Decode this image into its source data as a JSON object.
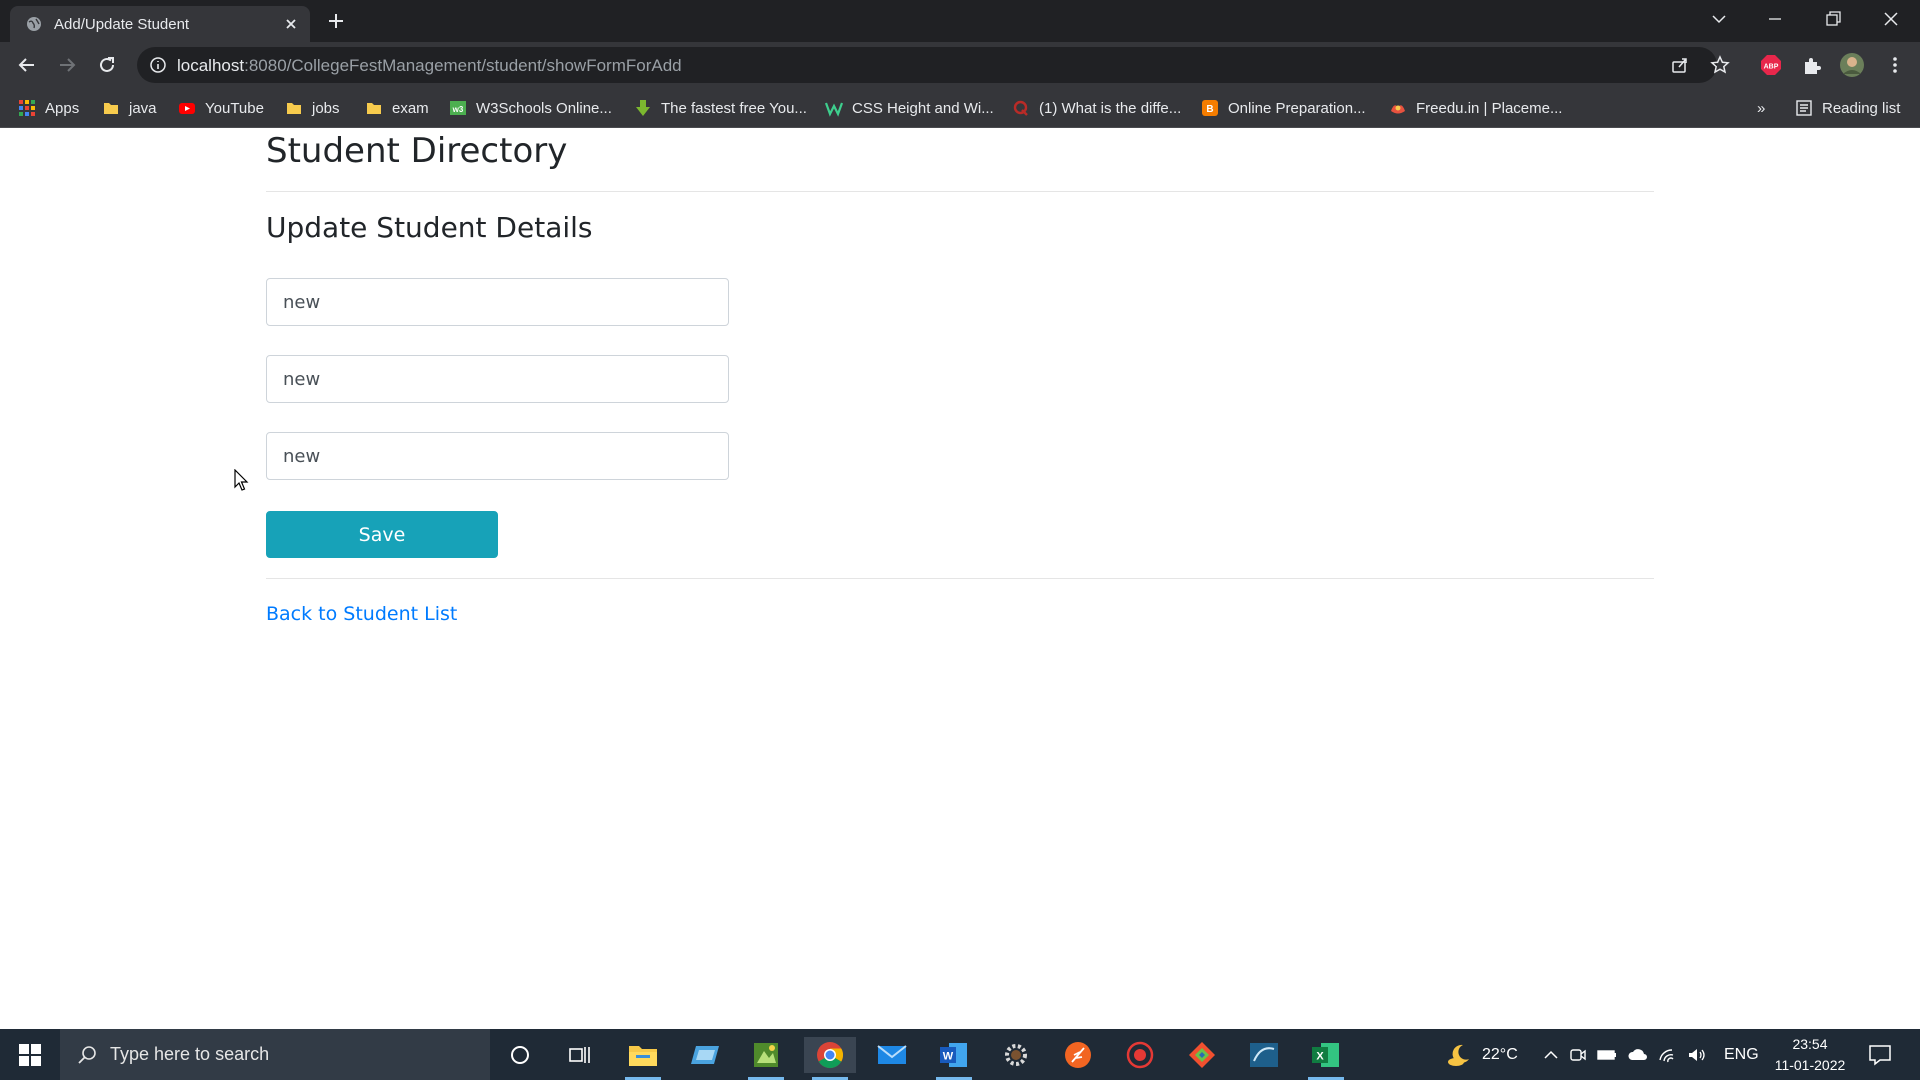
{
  "browser": {
    "tab_title": "Add/Update Student",
    "url_host": "localhost",
    "url_rest": ":8080/CollegeFestManagement/student/showFormForAdd",
    "bookmarks": [
      {
        "label": "Apps",
        "icon": "apps-grid-icon"
      },
      {
        "label": "java",
        "icon": "folder-icon"
      },
      {
        "label": "YouTube",
        "icon": "youtube-icon"
      },
      {
        "label": "jobs",
        "icon": "folder-icon"
      },
      {
        "label": "exam",
        "icon": "folder-icon"
      },
      {
        "label": "W3Schools Online...",
        "icon": "w3schools-icon"
      },
      {
        "label": "The fastest free You...",
        "icon": "download-arrow-icon"
      },
      {
        "label": "CSS Height and Wi...",
        "icon": "w-logo-icon"
      },
      {
        "label": "(1) What is the diffe...",
        "icon": "quora-icon"
      },
      {
        "label": "Online Preparation...",
        "icon": "blogger-icon"
      },
      {
        "label": "Freedu.in | Placeme...",
        "icon": "freedu-icon"
      }
    ],
    "reading_list": "Reading list",
    "overflow": "»"
  },
  "page": {
    "title": "Student Directory",
    "section_title": "Update Student Details",
    "fields": [
      {
        "value": "new"
      },
      {
        "value": "new"
      },
      {
        "value": "new"
      }
    ],
    "save_label": "Save",
    "back_link": "Back to Student List"
  },
  "taskbar": {
    "search_placeholder": "Type here to search",
    "weather": "22°C",
    "language": "ENG",
    "time": "23:54",
    "date": "11-01-2022"
  },
  "colors": {
    "save_button": "#17a2b8",
    "link": "#007bff",
    "chrome_dark": "#202124",
    "chrome_toolbar": "#35363a"
  }
}
